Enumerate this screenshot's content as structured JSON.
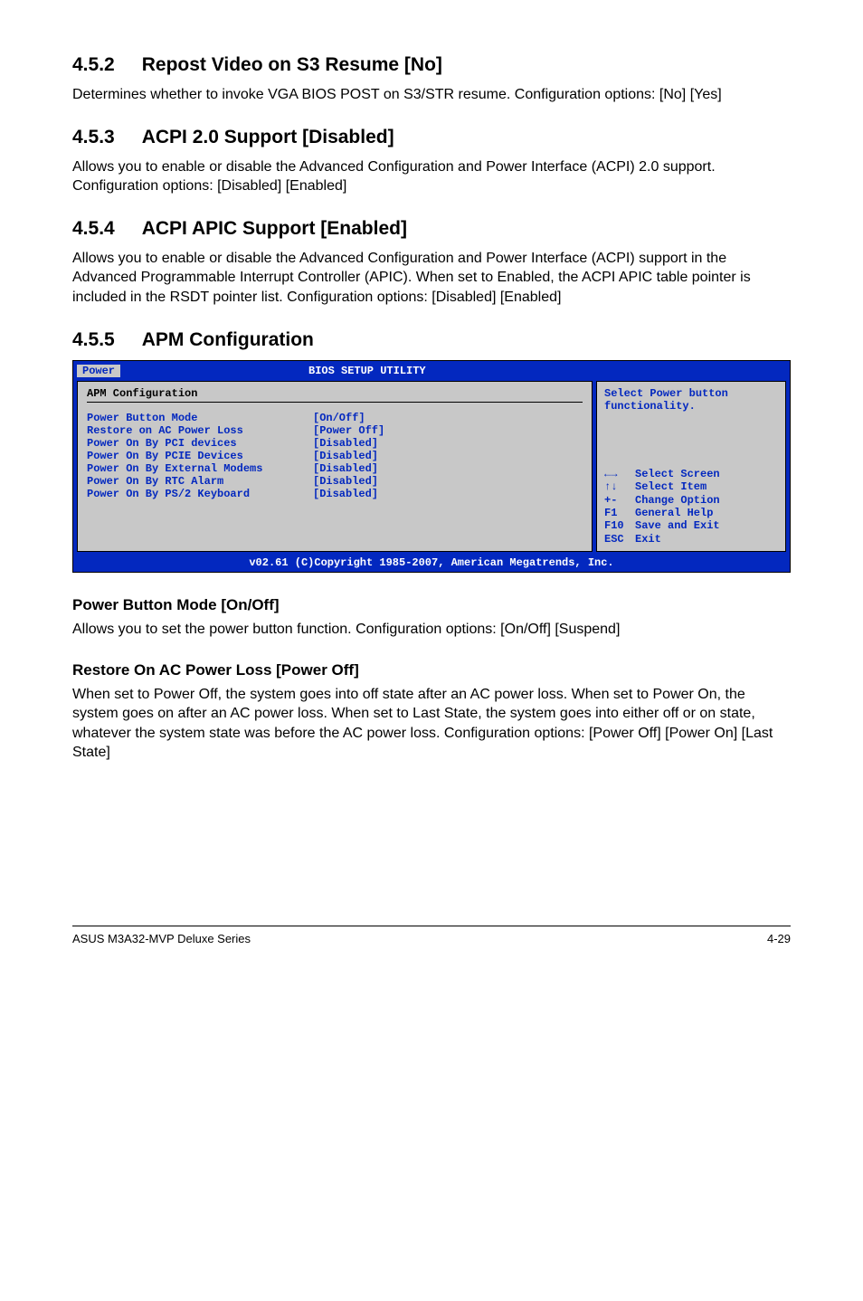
{
  "s452": {
    "num": "4.5.2",
    "title": "Repost Video on S3 Resume [No]",
    "body": "Determines whether to invoke VGA BIOS POST on S3/STR resume. Configuration options: [No] [Yes]"
  },
  "s453": {
    "num": "4.5.3",
    "title": "ACPI 2.0 Support [Disabled]",
    "body": "Allows you to enable or disable the Advanced Configuration and Power Interface (ACPI) 2.0 support. Configuration options: [Disabled] [Enabled]"
  },
  "s454": {
    "num": "4.5.4",
    "title": "ACPI APIC Support [Enabled]",
    "body": "Allows you to enable or disable the Advanced Configuration and Power Interface (ACPI) support in the Advanced Programmable Interrupt Controller (APIC). When set to Enabled, the ACPI APIC table pointer is included in the RSDT pointer list. Configuration options: [Disabled] [Enabled]"
  },
  "s455": {
    "num": "4.5.5",
    "title": "APM Configuration"
  },
  "bios": {
    "header": "BIOS SETUP UTILITY",
    "tab": "Power",
    "config_title": "APM Configuration",
    "rows": [
      {
        "label": "Power Button Mode",
        "value": "[On/Off]"
      },
      {
        "label": "Restore on AC Power Loss",
        "value": "[Power Off]"
      },
      {
        "label": "Power On By PCI devices",
        "value": "[Disabled]"
      },
      {
        "label": "Power On By PCIE Devices",
        "value": "[Disabled]"
      },
      {
        "label": "Power On By External Modems",
        "value": "[Disabled]"
      },
      {
        "label": "Power On By RTC Alarm",
        "value": "[Disabled]"
      },
      {
        "label": "Power On By PS/2 Keyboard",
        "value": "[Disabled]"
      }
    ],
    "hint": "Select Power button functionality.",
    "keys": [
      {
        "key": "←→",
        "action": "Select Screen"
      },
      {
        "key": "↑↓",
        "action": "Select Item"
      },
      {
        "key": "+-",
        "action": "Change Option"
      },
      {
        "key": "F1",
        "action": "General Help"
      },
      {
        "key": "F10",
        "action": "Save and Exit"
      },
      {
        "key": "ESC",
        "action": "Exit"
      }
    ],
    "footer": "v02.61 (C)Copyright 1985-2007, American Megatrends, Inc."
  },
  "sub1": {
    "title": "Power Button Mode [On/Off]",
    "body": "Allows you to set the power button function. Configuration options: [On/Off] [Suspend]"
  },
  "sub2": {
    "title": "Restore On AC Power Loss [Power Off]",
    "body": "When set to Power Off, the system goes into off state after an AC power loss. When set to Power On, the system goes on after an AC power loss. When set to Last State, the system goes into either off or on state, whatever the system state was before the AC power loss. Configuration options: [Power Off] [Power On] [Last State]"
  },
  "footer": {
    "left": "ASUS M3A32-MVP Deluxe Series",
    "right": "4-29"
  }
}
